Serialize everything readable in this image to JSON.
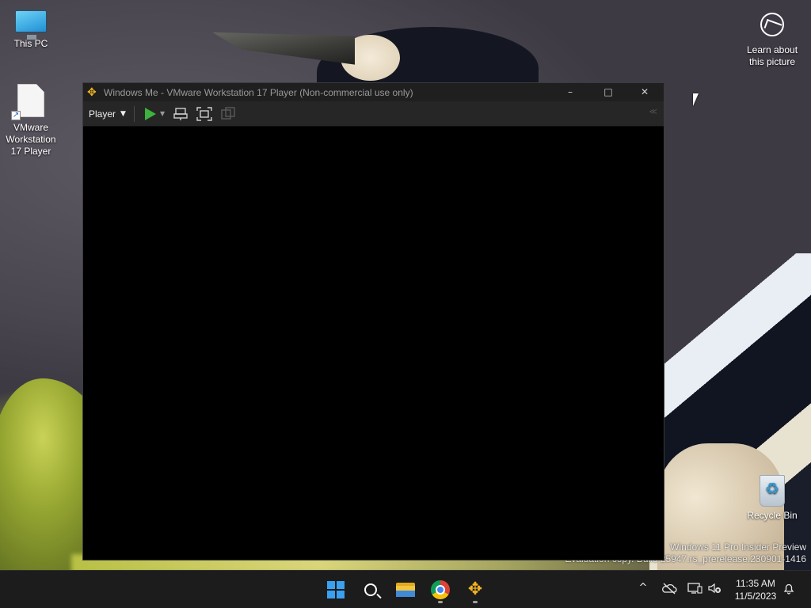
{
  "desktop": {
    "icons": [
      {
        "label": "This PC",
        "icon": "this-pc-icon"
      },
      {
        "label": "VMware Workstation 17 Player",
        "icon": "vmware-shortcut-icon"
      },
      {
        "label": "Learn about this picture",
        "icon": "learn-about-picture-icon"
      },
      {
        "label": "Recycle Bin",
        "icon": "recycle-bin-icon"
      }
    ],
    "vmware_label_lines": [
      "VMware",
      "Workstation",
      "17 Player"
    ],
    "learn_label_lines": [
      "Learn about",
      "this picture"
    ]
  },
  "window": {
    "title": "Windows Me - VMware Workstation 17 Player (Non-commercial use only)",
    "controls": {
      "minimize": "–",
      "maximize": "□",
      "close": "✕"
    },
    "toolbar": {
      "player_menu": "Player",
      "icons": [
        "play-icon",
        "play-options-caret-icon",
        "send-ctrl-alt-del-icon",
        "full-screen-icon",
        "unity-icon",
        "collapse-toolbar-icon"
      ]
    }
  },
  "watermark": {
    "line1": "Windows 11 Pro Insider Preview",
    "line2": "Evaluation copy. Build 25947.rs_prerelease.230901-1416"
  },
  "taskbar": {
    "apps": [
      "start-icon",
      "search-icon",
      "file-explorer-icon",
      "chrome-icon",
      "vmware-player-icon"
    ],
    "tray": {
      "chevron": "^",
      "icons": [
        "onedrive-icon",
        "network-icon",
        "volume-muted-icon",
        "notifications-icon"
      ]
    },
    "clock": {
      "time": "11:35 AM",
      "date": "11/5/2023"
    }
  },
  "colors": {
    "taskbar_bg": "#1c1c1c",
    "window_title_bg": "#1f1f1f",
    "toolbar_bg": "#262626",
    "play_green": "#3db33d",
    "vmware_yellow": "#f3b421",
    "windows_blue": "#3aa0f0"
  }
}
